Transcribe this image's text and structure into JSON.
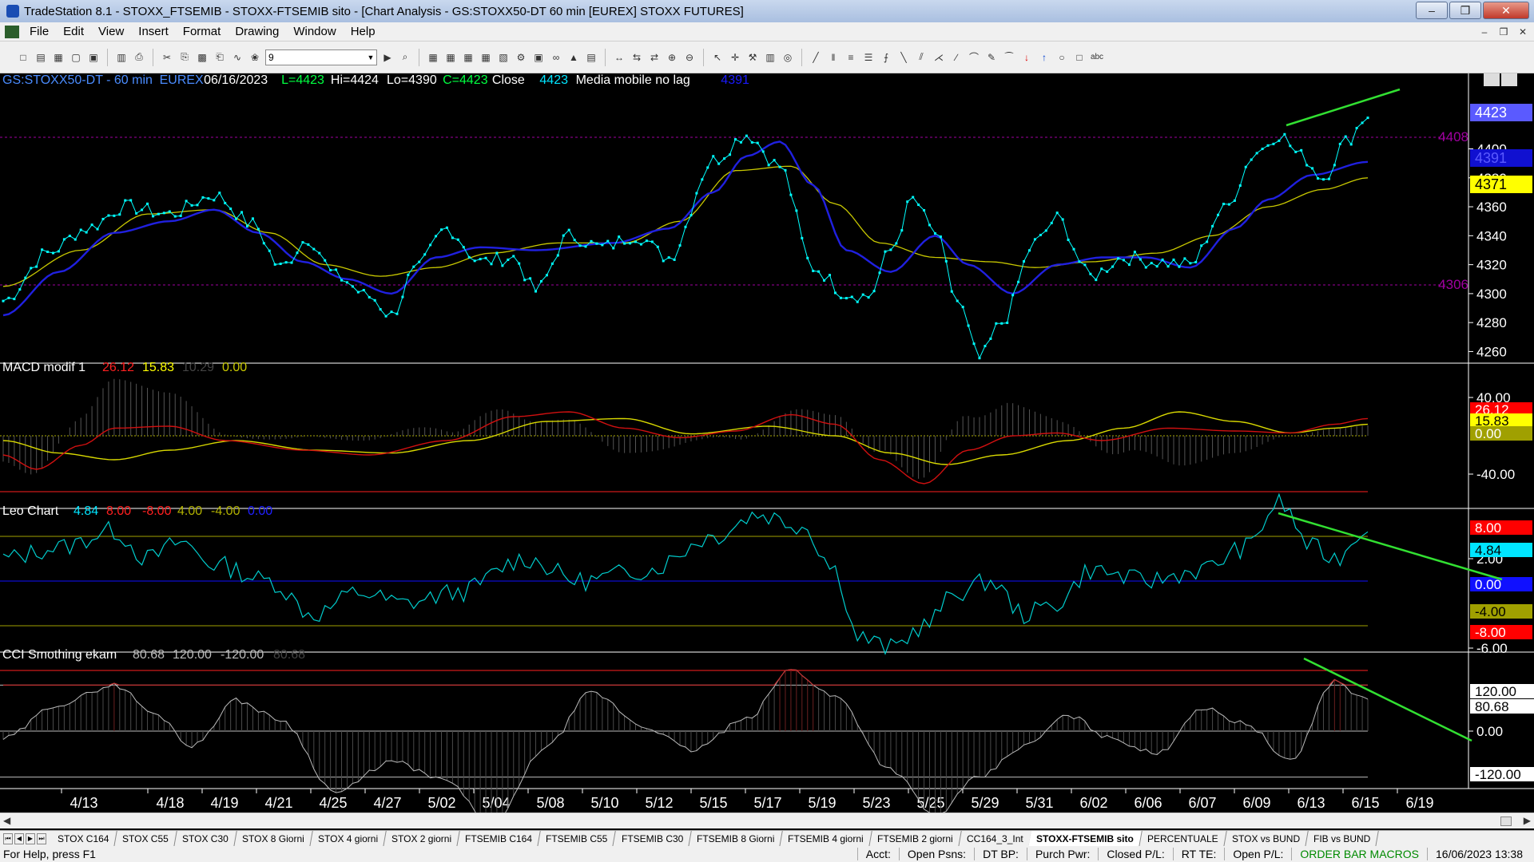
{
  "window": {
    "title": "TradeStation 8.1 - STOXX_FTSEMIB - STOXX-FTSEMIB sito - [Chart Analysis - GS:STOXX50-DT  60 min  [EUREX] STOXX FUTURES]",
    "buttons": [
      "minimize",
      "maximize",
      "close"
    ]
  },
  "menu": [
    "File",
    "Edit",
    "View",
    "Insert",
    "Format",
    "Drawing",
    "Window",
    "Help"
  ],
  "toolbar": {
    "combo_value": "9"
  },
  "price_pane": {
    "header": {
      "symbol": "GS:STOXX50-DT - 60 min",
      "exchange": "EUREX",
      "date": "06/16/2023",
      "low": "L=4423",
      "high": "Hi=4424",
      "lo": "Lo=4390",
      "close": "C=4423",
      "close_label": "Close",
      "close_value": "4423",
      "ma_label": "Media mobile no lag",
      "ma_value": "4391"
    },
    "ref_levels": [
      "4408",
      "4306"
    ],
    "axis_ticks": [
      "4400",
      "4380",
      "4360",
      "4340",
      "4320",
      "4300",
      "4280",
      "4260"
    ],
    "markers": [
      {
        "label": "4423",
        "color": "#5a5aff",
        "textcolor": "#ffffff"
      },
      {
        "label": "4391",
        "color": "#1010d0",
        "textcolor": "#5a5aff"
      },
      {
        "label": "4371",
        "color": "#ffff00",
        "textcolor": "#000000"
      }
    ]
  },
  "macd_pane": {
    "header": {
      "name": "MACD modif 1",
      "v1": "26.12",
      "v2": "15.83",
      "v3": "10.29",
      "v4": "0.00"
    },
    "axis_ticks": [
      "40.00",
      "-40.00"
    ],
    "markers": [
      {
        "label": "26.12",
        "color": "#ff0000",
        "textcolor": "#ffffff"
      },
      {
        "label": "15.83",
        "color": "#ffff00",
        "textcolor": "#000000"
      },
      {
        "label": "0.00",
        "color": "#a0a000",
        "textcolor": "#ffffff"
      }
    ]
  },
  "leo_pane": {
    "header": {
      "name": "Leo Chart",
      "v1": "4.84",
      "v2": "8.00",
      "v3": "-8.00",
      "v4": "4.00",
      "v5": "-4.00",
      "v6": "0.00"
    },
    "axis_ticks": [
      "2.00",
      "-6.00"
    ],
    "markers": [
      {
        "label": "8.00",
        "color": "#ff0000",
        "textcolor": "#ffffff"
      },
      {
        "label": "4.84",
        "color": "#00e5ff",
        "textcolor": "#000000"
      },
      {
        "label": "0.00",
        "color": "#1010ff",
        "textcolor": "#ffffff"
      },
      {
        "label": "-4.00",
        "color": "#a0a000",
        "textcolor": "#000000"
      },
      {
        "label": "-8.00",
        "color": "#ff0000",
        "textcolor": "#ffffff"
      }
    ]
  },
  "cci_pane": {
    "header": {
      "name": "CCI Smothing ekam",
      "v1": "80.68",
      "v2": "120.00",
      "v3": "-120.00",
      "v4": "80.68"
    },
    "axis_ticks": [
      "0.00"
    ],
    "markers": [
      {
        "label": "120.00",
        "color": "#ffffff",
        "textcolor": "#000000"
      },
      {
        "label": "80.68",
        "color": "#ffffff",
        "textcolor": "#000000"
      },
      {
        "label": "-120.00",
        "color": "#ffffff",
        "textcolor": "#000000"
      }
    ]
  },
  "x_axis": [
    "4/13",
    "4/18",
    "4/19",
    "4/21",
    "4/25",
    "4/27",
    "5/02",
    "5/04",
    "5/08",
    "5/10",
    "5/12",
    "5/15",
    "5/17",
    "5/19",
    "5/23",
    "5/25",
    "5/29",
    "5/31",
    "6/02",
    "6/06",
    "6/07",
    "6/09",
    "6/13",
    "6/15",
    "6/19"
  ],
  "tabs": [
    "STOX C164",
    "STOX C55",
    "STOX  C30",
    "STOX  8 Giorni",
    "STOX 4 giorni",
    "STOX  2 giorni",
    "FTSEMIB C164",
    "FTSEMIB C55",
    "FTSEMIB C30",
    "FTSEMIB  8 Giorni",
    "FTSEMIB  4 giorni",
    "FTSEMIB  2 giorni",
    "CC164_3_Int",
    "STOXX-FTSEMIB sito",
    "PERCENTUALE",
    "STOX vs BUND",
    "FIB vs BUND"
  ],
  "active_tab": "STOXX-FTSEMIB sito",
  "status": {
    "help": "For Help, press F1",
    "acct": "Acct:",
    "open_psns": "Open Psns:",
    "dt_bp": "DT BP:",
    "purch_pwr": "Purch Pwr:",
    "closed_pl": "Closed P/L:",
    "rt_te": "RT TE:",
    "open_pl": "Open P/L:",
    "macros": "ORDER BAR  MACROS",
    "datetime": "16/06/2023 13:38"
  },
  "chart_data": {
    "type": "line",
    "price_keypoints": [
      [
        0,
        4295
      ],
      [
        8,
        4328
      ],
      [
        15,
        4345
      ],
      [
        22,
        4360
      ],
      [
        30,
        4355
      ],
      [
        38,
        4368
      ],
      [
        45,
        4348
      ],
      [
        50,
        4318
      ],
      [
        55,
        4338
      ],
      [
        60,
        4312
      ],
      [
        66,
        4298
      ],
      [
        70,
        4285
      ],
      [
        74,
        4315
      ],
      [
        80,
        4345
      ],
      [
        86,
        4322
      ],
      [
        92,
        4325
      ],
      [
        96,
        4302
      ],
      [
        102,
        4340
      ],
      [
        108,
        4332
      ],
      [
        114,
        4340
      ],
      [
        120,
        4325
      ],
      [
        128,
        4392
      ],
      [
        134,
        4410
      ],
      [
        140,
        4388
      ],
      [
        146,
        4318
      ],
      [
        152,
        4300
      ],
      [
        156,
        4298
      ],
      [
        160,
        4330
      ],
      [
        164,
        4365
      ],
      [
        168,
        4342
      ],
      [
        172,
        4295
      ],
      [
        176,
        4255
      ],
      [
        180,
        4280
      ],
      [
        186,
        4335
      ],
      [
        190,
        4352
      ],
      [
        196,
        4312
      ],
      [
        202,
        4325
      ],
      [
        208,
        4322
      ],
      [
        214,
        4320
      ],
      [
        220,
        4358
      ],
      [
        226,
        4398
      ],
      [
        230,
        4410
      ],
      [
        234,
        4395
      ],
      [
        238,
        4380
      ],
      [
        242,
        4405
      ],
      [
        246,
        4423
      ]
    ],
    "ma_blue_keypoints": [
      [
        0,
        4285
      ],
      [
        10,
        4315
      ],
      [
        20,
        4342
      ],
      [
        30,
        4350
      ],
      [
        38,
        4358
      ],
      [
        46,
        4342
      ],
      [
        54,
        4322
      ],
      [
        62,
        4310
      ],
      [
        70,
        4300
      ],
      [
        78,
        4325
      ],
      [
        86,
        4332
      ],
      [
        96,
        4330
      ],
      [
        110,
        4335
      ],
      [
        120,
        4345
      ],
      [
        128,
        4370
      ],
      [
        134,
        4395
      ],
      [
        140,
        4405
      ],
      [
        146,
        4375
      ],
      [
        152,
        4330
      ],
      [
        160,
        4315
      ],
      [
        168,
        4340
      ],
      [
        174,
        4320
      ],
      [
        182,
        4300
      ],
      [
        190,
        4320
      ],
      [
        198,
        4325
      ],
      [
        206,
        4325
      ],
      [
        214,
        4318
      ],
      [
        222,
        4345
      ],
      [
        228,
        4365
      ],
      [
        236,
        4382
      ],
      [
        246,
        4391
      ]
    ],
    "ma_yellow_keypoints": [
      [
        0,
        4305
      ],
      [
        14,
        4330
      ],
      [
        26,
        4355
      ],
      [
        38,
        4358
      ],
      [
        48,
        4342
      ],
      [
        58,
        4320
      ],
      [
        68,
        4312
      ],
      [
        78,
        4318
      ],
      [
        88,
        4328
      ],
      [
        100,
        4335
      ],
      [
        112,
        4335
      ],
      [
        122,
        4350
      ],
      [
        132,
        4385
      ],
      [
        142,
        4388
      ],
      [
        150,
        4362
      ],
      [
        158,
        4335
      ],
      [
        168,
        4325
      ],
      [
        178,
        4322
      ],
      [
        186,
        4318
      ],
      [
        196,
        4322
      ],
      [
        208,
        4328
      ],
      [
        218,
        4340
      ],
      [
        228,
        4360
      ],
      [
        238,
        4372
      ],
      [
        246,
        4380
      ]
    ],
    "macd_red_keypoints": [
      [
        0,
        -20
      ],
      [
        6,
        -35
      ],
      [
        14,
        -10
      ],
      [
        20,
        8
      ],
      [
        30,
        10
      ],
      [
        40,
        -5
      ],
      [
        54,
        -15
      ],
      [
        66,
        -20
      ],
      [
        80,
        -5
      ],
      [
        92,
        20
      ],
      [
        102,
        25
      ],
      [
        112,
        8
      ],
      [
        122,
        -2
      ],
      [
        132,
        5
      ],
      [
        142,
        22
      ],
      [
        150,
        12
      ],
      [
        158,
        -25
      ],
      [
        166,
        -50
      ],
      [
        174,
        -15
      ],
      [
        182,
        0
      ],
      [
        190,
        3
      ],
      [
        198,
        -5
      ],
      [
        210,
        8
      ],
      [
        222,
        5
      ],
      [
        232,
        3
      ],
      [
        240,
        12
      ],
      [
        246,
        18
      ]
    ],
    "macd_yellow_keypoints": [
      [
        0,
        -5
      ],
      [
        10,
        -18
      ],
      [
        20,
        -25
      ],
      [
        30,
        -15
      ],
      [
        42,
        -5
      ],
      [
        56,
        -15
      ],
      [
        70,
        -18
      ],
      [
        84,
        -5
      ],
      [
        98,
        15
      ],
      [
        112,
        18
      ],
      [
        124,
        2
      ],
      [
        138,
        10
      ],
      [
        150,
        0
      ],
      [
        160,
        -18
      ],
      [
        170,
        -30
      ],
      [
        180,
        -20
      ],
      [
        192,
        -5
      ],
      [
        202,
        8
      ],
      [
        212,
        25
      ],
      [
        222,
        15
      ],
      [
        232,
        3
      ],
      [
        240,
        8
      ],
      [
        246,
        12
      ]
    ],
    "leo_keypoints": [
      [
        0,
        2
      ],
      [
        10,
        3
      ],
      [
        20,
        4.5
      ],
      [
        26,
        2
      ],
      [
        32,
        3.5
      ],
      [
        38,
        1.5
      ],
      [
        48,
        0
      ],
      [
        56,
        -3
      ],
      [
        64,
        -1
      ],
      [
        72,
        -2
      ],
      [
        82,
        -1
      ],
      [
        94,
        2
      ],
      [
        104,
        0
      ],
      [
        116,
        1
      ],
      [
        128,
        4
      ],
      [
        136,
        6
      ],
      [
        144,
        5
      ],
      [
        150,
        1
      ],
      [
        154,
        -5
      ],
      [
        160,
        -6
      ],
      [
        166,
        -4
      ],
      [
        172,
        -1
      ],
      [
        178,
        0
      ],
      [
        184,
        -3
      ],
      [
        190,
        -2
      ],
      [
        196,
        1
      ],
      [
        206,
        0
      ],
      [
        216,
        1
      ],
      [
        224,
        3
      ],
      [
        230,
        7
      ],
      [
        236,
        3
      ],
      [
        240,
        2
      ],
      [
        246,
        4.84
      ]
    ],
    "cci_keypoints": [
      [
        0,
        -20
      ],
      [
        10,
        70
      ],
      [
        20,
        120
      ],
      [
        28,
        40
      ],
      [
        34,
        -40
      ],
      [
        42,
        80
      ],
      [
        50,
        30
      ],
      [
        60,
        -160
      ],
      [
        70,
        -80
      ],
      [
        80,
        -130
      ],
      [
        88,
        -250
      ],
      [
        98,
        -40
      ],
      [
        106,
        100
      ],
      [
        116,
        10
      ],
      [
        124,
        -50
      ],
      [
        134,
        30
      ],
      [
        142,
        160
      ],
      [
        150,
        90
      ],
      [
        160,
        -100
      ],
      [
        168,
        -220
      ],
      [
        176,
        -120
      ],
      [
        184,
        -40
      ],
      [
        192,
        40
      ],
      [
        200,
        -20
      ],
      [
        208,
        -60
      ],
      [
        216,
        60
      ],
      [
        224,
        20
      ],
      [
        232,
        -80
      ],
      [
        240,
        130
      ],
      [
        246,
        80.68
      ]
    ]
  },
  "colors": {
    "price_dots": "#00ffff",
    "ma_blue": "#2020e0",
    "ma_yellow": "#c8c800",
    "trend_line": "#32e032",
    "ref_level": "#a000a0",
    "macd_red": "#d01010",
    "macd_yellow": "#d8d800",
    "leo_line": "#00cccc",
    "cci_line": "#bbbbbb",
    "cci_hist_pos": "#c03030"
  }
}
